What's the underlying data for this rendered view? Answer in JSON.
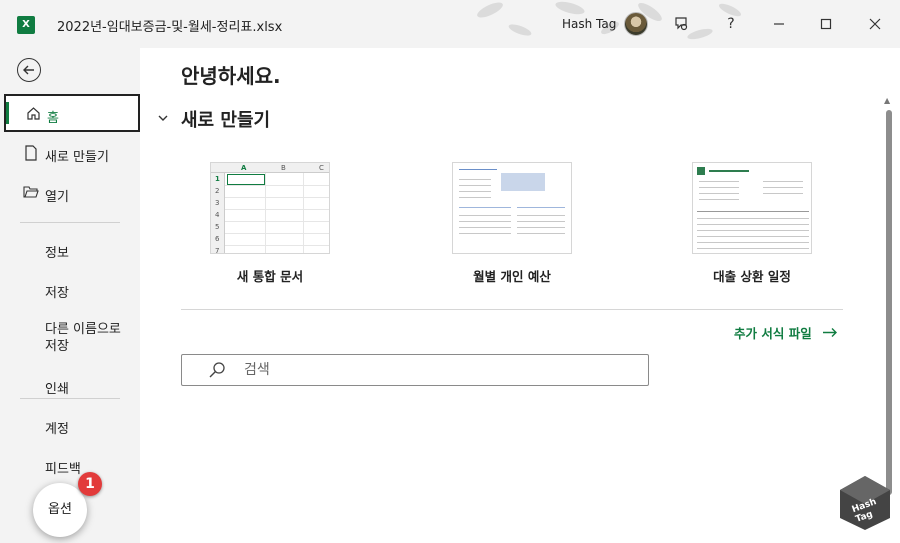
{
  "titlebar": {
    "app_icon_letter": "X",
    "document_title": "2022년-임대보증금-및-월세-정리표.xlsx",
    "user_name": "Hash Tag",
    "feedback_icon": "feedback-icon",
    "help_label": "?",
    "minimize_icon": "minimize-icon",
    "maximize_icon": "maximize-icon",
    "close_icon": "close-icon"
  },
  "nav": {
    "back_icon": "back-arrow-icon",
    "home_label": "홈",
    "new_label": "새로 만들기",
    "open_label": "열기",
    "info_label": "정보",
    "save_label": "저장",
    "save_as_line1": "다른 이름으로",
    "save_as_line2": "저장",
    "print_label": "인쇄",
    "account_label": "계정",
    "feedback_label": "피드백",
    "options_label": "옵션",
    "badge_number": "1",
    "accent_color": "#107c41"
  },
  "main": {
    "greeting": "안녕하세요.",
    "section_title": "새로 만들기",
    "templates": [
      {
        "label": "새 통합 문서"
      },
      {
        "label": "월별 개인 예산"
      },
      {
        "label": "대출 상환 일정"
      }
    ],
    "more_templates": "추가 서식 파일",
    "search_placeholder": "검색"
  },
  "grid": {
    "columns": [
      "A",
      "B",
      "C"
    ],
    "rows": [
      "1",
      "2",
      "3",
      "4",
      "5",
      "6",
      "7"
    ]
  }
}
